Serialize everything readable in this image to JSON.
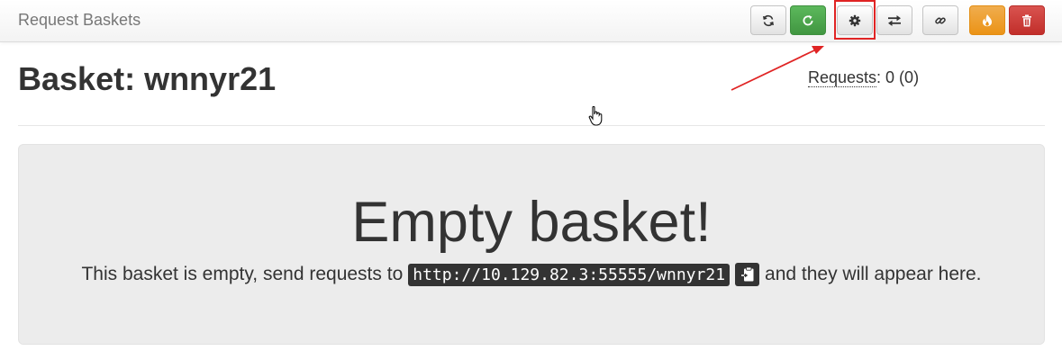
{
  "navbar": {
    "brand": "Request Baskets",
    "buttons": [
      {
        "name": "refresh-button",
        "icon": "refresh-icon"
      },
      {
        "name": "auto-refresh-button",
        "icon": "rotate-right-icon"
      },
      {
        "name": "settings-button",
        "icon": "gear-icon"
      },
      {
        "name": "responses-button",
        "icon": "transfer-icon"
      },
      {
        "name": "share-link-button",
        "icon": "link-icon"
      },
      {
        "name": "clear-button",
        "icon": "fire-icon"
      },
      {
        "name": "delete-button",
        "icon": "trash-icon"
      }
    ]
  },
  "basket": {
    "title": "Basket: wnnyr21",
    "requests_label": "Requests",
    "requests_value": ": 0 (0)"
  },
  "empty": {
    "heading": "Empty basket!",
    "text_before": "This basket is empty, send requests to",
    "url": "http://10.129.82.3:55555/wnnyr21",
    "text_after": "and they will appear here."
  },
  "colors": {
    "success": "#5cb85c",
    "warning": "#f0ad4e",
    "danger": "#d9534f",
    "annotation": "#e02424"
  }
}
